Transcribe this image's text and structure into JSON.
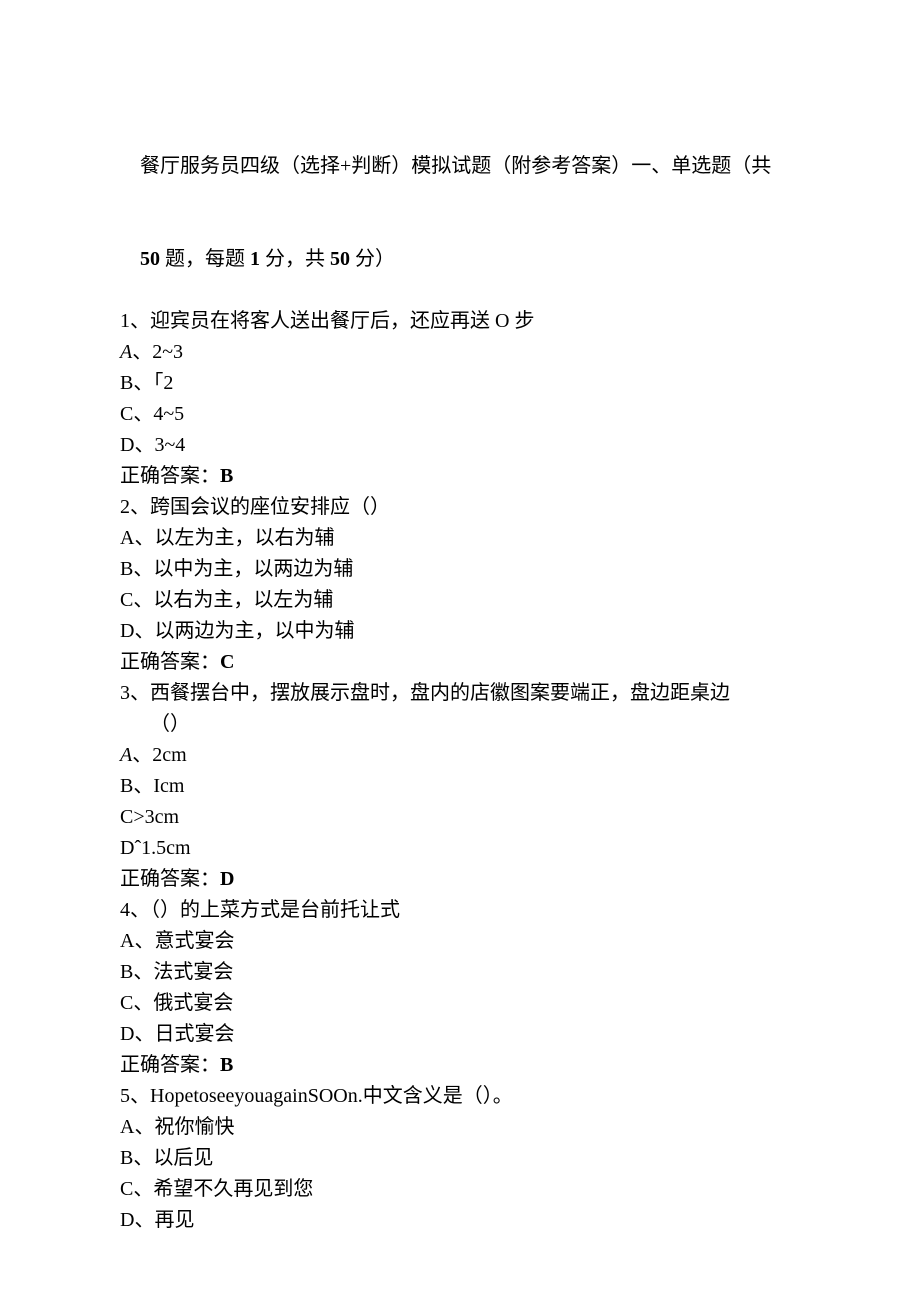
{
  "header": {
    "line1_part1": "餐厅服务员四级（选择+判断）模拟试题（附参考答案）一、单选题（共",
    "line2_bold_a": "50",
    "line2_mid_a": " 题，每题 ",
    "line2_bold_b": "1",
    "line2_mid_b": " 分，共 ",
    "line2_bold_c": "50",
    "line2_end": " 分）"
  },
  "q1": {
    "stem": "1、迎宾员在将客人送出餐厅后，还应再送 O 步",
    "optA_bullet": "A",
    "optA": "、2~3",
    "optB": "B、「2",
    "optC": "C、4~5",
    "optD": "D、3~4",
    "ans_label": "正确答案：",
    "ans_val": "B"
  },
  "q2": {
    "stem": "2、跨国会议的座位安排应（）",
    "optA": "A、以左为主，以右为辅",
    "optB": "B、以中为主，以两边为辅",
    "optC": "C、以右为主，以左为辅",
    "optD": "D、以两边为主，以中为辅",
    "ans_label": "正确答案：",
    "ans_val": "C"
  },
  "q3": {
    "stem1": "3、西餐摆台中，摆放展示盘时，盘内的店徽图案要端正，盘边距桌边",
    "stem2": "（）",
    "optA_bullet": "A",
    "optA": "、2cm",
    "optB": "B、Icm",
    "optC": "C>3cm",
    "optD": "Dˆ1.5cm",
    "ans_label": "正确答案：",
    "ans_val": "D"
  },
  "q4": {
    "stem": "4、（）的上菜方式是台前托让式",
    "optA": "A、意式宴会",
    "optB": "B、法式宴会",
    "optC": "C、俄式宴会",
    "optD": "D、日式宴会",
    "ans_label": "正确答案：",
    "ans_val": "B"
  },
  "q5": {
    "stem": "5、HopetoseeyouagainSOOn.中文含义是（）。",
    "optA": "A、祝你愉快",
    "optB": "B、以后见",
    "optC": "C、希望不久再见到您",
    "optD": "D、再见"
  }
}
